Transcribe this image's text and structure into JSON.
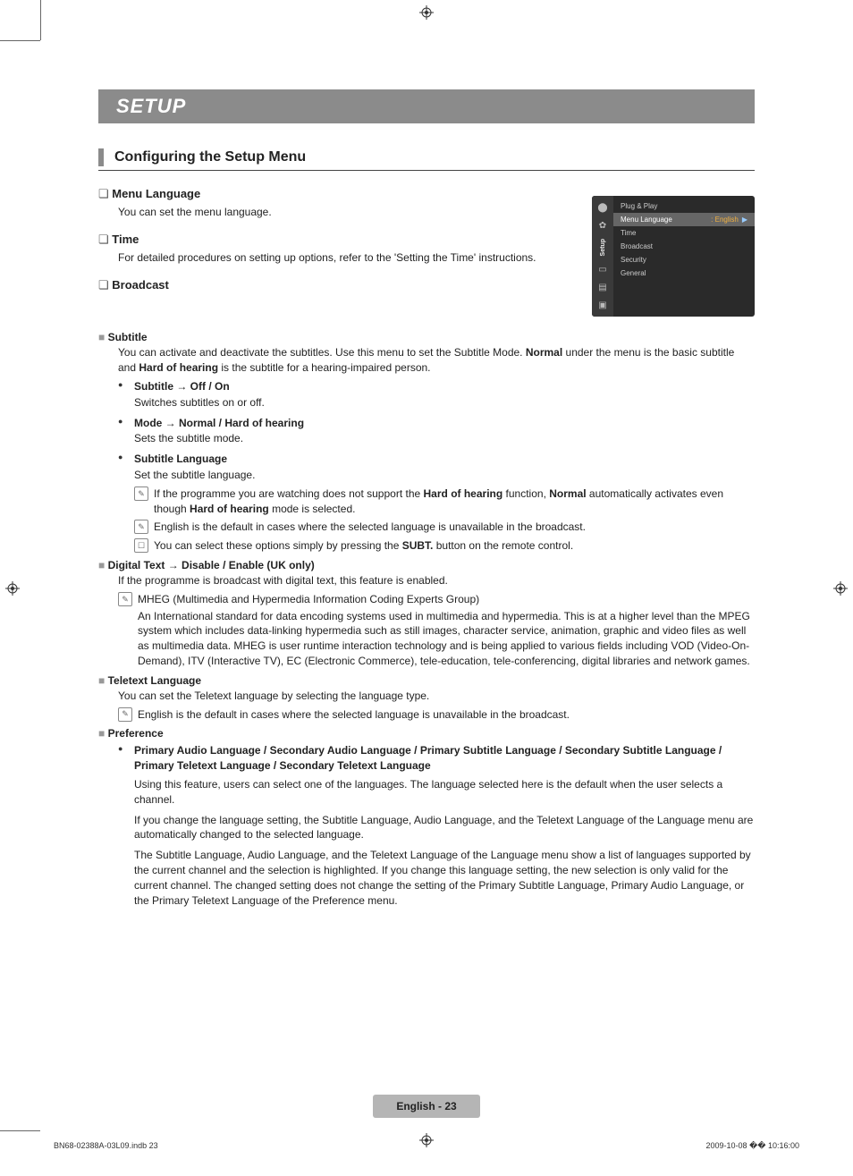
{
  "header": {
    "title": "SETUP"
  },
  "section": {
    "title": "Configuring the Setup Menu"
  },
  "osd": {
    "sidebarLabel": "Setup",
    "rows": [
      {
        "label": "Plug & Play",
        "value": "",
        "selected": false
      },
      {
        "label": "Menu Language",
        "value": ": English",
        "selected": true
      },
      {
        "label": "Time",
        "value": "",
        "selected": false
      },
      {
        "label": "Broadcast",
        "value": "",
        "selected": false
      },
      {
        "label": "Security",
        "value": "",
        "selected": false
      },
      {
        "label": "General",
        "value": "",
        "selected": false
      }
    ]
  },
  "q": {
    "menuLanguage": {
      "title": "Menu Language",
      "body": "You can set the menu language."
    },
    "time": {
      "title": "Time",
      "body": "For detailed procedures on setting up options, refer to the 'Setting the Time' instructions."
    },
    "broadcast": {
      "title": "Broadcast"
    }
  },
  "subtitle": {
    "title": "Subtitle",
    "intro1": "You can activate and deactivate the subtitles. Use this menu to set the Subtitle Mode. ",
    "introBold1": "Normal",
    "intro2": " under the menu is the basic subtitle and ",
    "introBold2": "Hard of hearing",
    "intro3": " is the subtitle for a hearing-impaired person.",
    "items": [
      {
        "title": "Subtitle → Off / On",
        "body": "Switches subtitles on or off."
      },
      {
        "title": "Mode → Normal / Hard of hearing",
        "body": "Sets the subtitle mode."
      },
      {
        "title": "Subtitle Language",
        "body": "Set the subtitle language."
      }
    ],
    "notes": {
      "n1a": "If the programme you are watching does not support the ",
      "n1b": "Hard of hearing",
      "n1c": " function, ",
      "n1d": "Normal",
      "n1e": " automatically activates even though ",
      "n1f": "Hard of hearing",
      "n1g": " mode is selected.",
      "n2": "English is the default in cases where the selected language is unavailable in the broadcast.",
      "n3a": "You can select these options simply by pressing the ",
      "n3b": "SUBT.",
      "n3c": " button on the remote control."
    }
  },
  "digitalText": {
    "title": "Digital Text → Disable / Enable (UK only)",
    "body": "If the programme is broadcast with digital text, this feature is enabled.",
    "noteTitle": "MHEG (Multimedia and Hypermedia Information Coding Experts Group)",
    "noteBody": "An International standard for data encoding systems used in multimedia and hypermedia. This is at a higher level than the MPEG system which includes data-linking hypermedia such as still images, character service, animation, graphic and video files as well as multimedia data. MHEG is user runtime interaction technology and is being applied to various fields including VOD (Video-On-Demand), ITV (Interactive TV), EC (Electronic Commerce), tele-education, tele-conferencing, digital libraries and network games."
  },
  "teletext": {
    "title": "Teletext Language",
    "body": "You can set the Teletext language by selecting the language type.",
    "note": "English is the default in cases where the selected language is unavailable in the broadcast."
  },
  "preference": {
    "title": "Preference",
    "bulTitle": "Primary Audio Language / Secondary Audio Language / Primary Subtitle Language / Secondary Subtitle Language / Primary Teletext Language / Secondary Teletext Language",
    "p1": "Using this feature, users can select one of the languages. The language selected here is the default when the user selects a channel.",
    "p2": "If you change the language setting, the Subtitle Language, Audio Language, and the Teletext Language of the Language menu are automatically changed to the selected language.",
    "p3": "The Subtitle Language, Audio Language, and the Teletext Language of the Language menu show a list of languages supported by the current channel and the selection is highlighted. If you change this language setting, the new selection is only valid for the current channel. The changed setting does not change the setting of the Primary Subtitle Language, Primary Audio Language, or the Primary Teletext Language of the Preference menu."
  },
  "footer": {
    "page": "English - 23",
    "left": "BN68-02388A-03L09.indb   23",
    "right": "2009-10-08   �� 10:16:00"
  }
}
